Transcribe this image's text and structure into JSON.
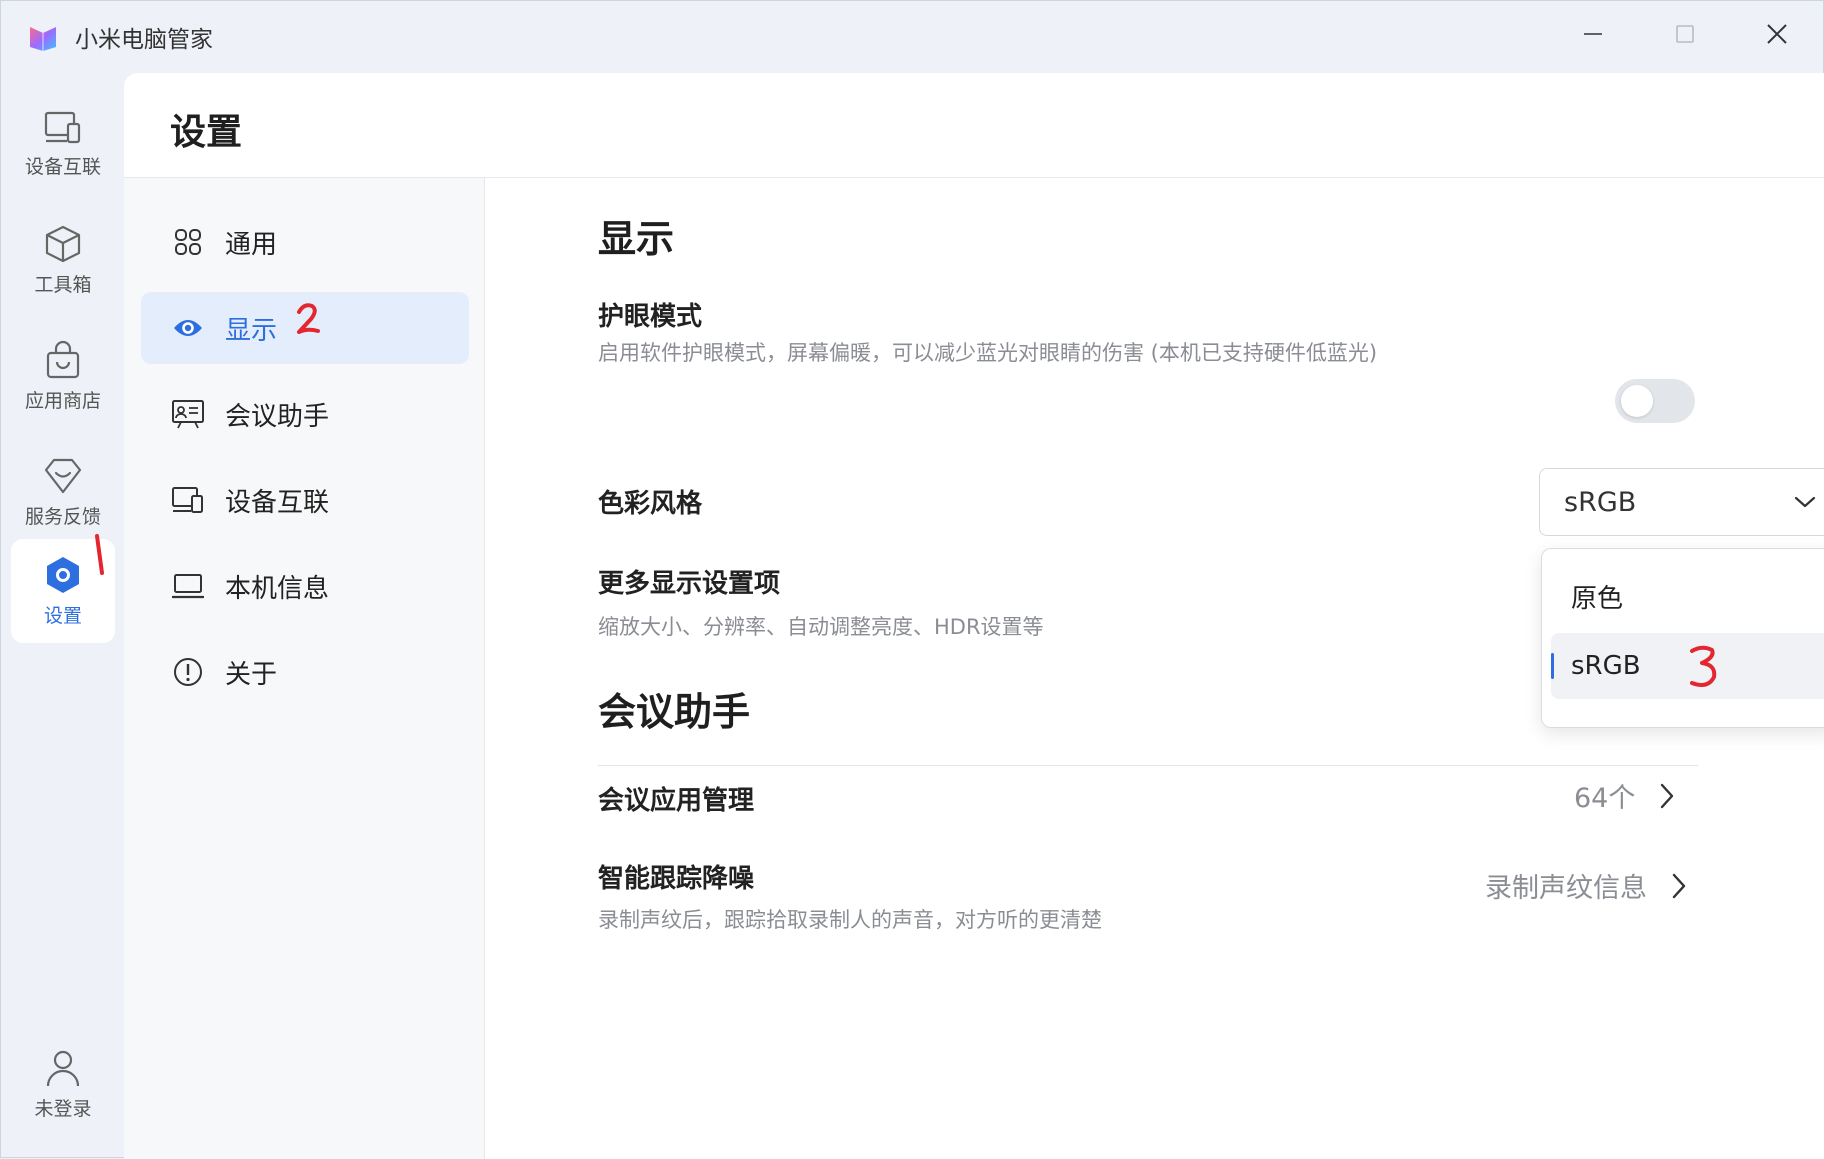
{
  "app": {
    "title": "小米电脑管家"
  },
  "window_controls": {
    "minimize_icon": "minimize-icon",
    "maximize_icon": "maximize-icon",
    "close_icon": "close-icon"
  },
  "rail": {
    "items": [
      {
        "label": "设备互联",
        "icon": "devices-icon"
      },
      {
        "label": "工具箱",
        "icon": "cube-icon"
      },
      {
        "label": "应用商店",
        "icon": "shopping-bag-icon"
      },
      {
        "label": "服务反馈",
        "icon": "diamond-heart-icon"
      },
      {
        "label": "设置",
        "icon": "settings-hex-icon",
        "active": true
      }
    ],
    "user": {
      "label": "未登录",
      "icon": "user-icon"
    }
  },
  "page": {
    "title": "设置"
  },
  "nav": {
    "items": [
      {
        "label": "通用",
        "icon": "grid-icon"
      },
      {
        "label": "显示",
        "icon": "eye-icon",
        "active": true
      },
      {
        "label": "会议助手",
        "icon": "presentation-icon"
      },
      {
        "label": "设备互联",
        "icon": "devices-icon"
      },
      {
        "label": "本机信息",
        "icon": "laptop-icon"
      },
      {
        "label": "关于",
        "icon": "info-icon"
      }
    ]
  },
  "display": {
    "title": "显示",
    "eye_care": {
      "title": "护眼模式",
      "desc": "启用软件护眼模式，屏幕偏暖，可以减少蓝光对眼睛的伤害 (本机已支持硬件低蓝光)",
      "enabled": false
    },
    "color_style": {
      "title": "色彩风格",
      "value": "sRGB",
      "options": [
        "原色",
        "sRGB"
      ],
      "selected_index": 1
    },
    "more": {
      "title": "更多显示设置项",
      "desc": "缩放大小、分辨率、自动调整亮度、HDR设置等"
    }
  },
  "meeting": {
    "title": "会议助手",
    "app_mgmt": {
      "title": "会议应用管理",
      "value": "64个"
    },
    "noise": {
      "title": "智能跟踪降噪",
      "desc": "录制声纹后，跟踪拾取录制人的声音，对方听的更清楚",
      "action": "录制声纹信息"
    }
  },
  "annotations": {
    "step1": "1",
    "step2": "2",
    "step3": "3",
    "color": "#e3262f"
  },
  "colors": {
    "accent": "#2e6fe0",
    "nav_active_bg": "#e4edfb",
    "rail_bg": "#eef2f8"
  }
}
